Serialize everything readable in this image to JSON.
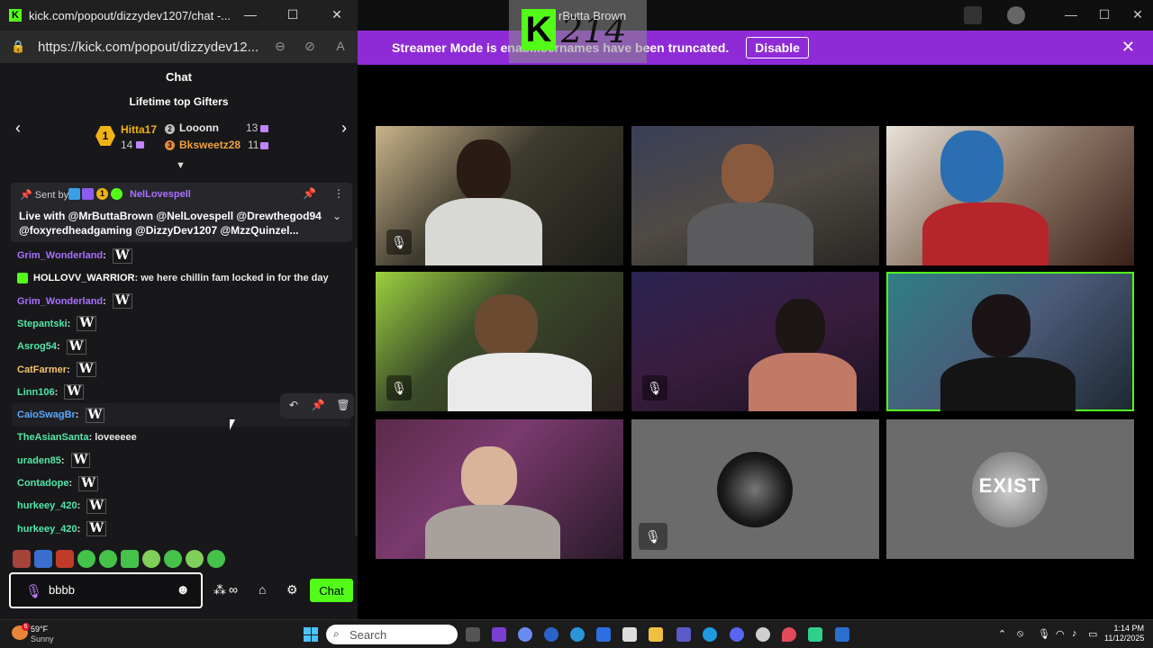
{
  "colors": {
    "kick_green": "#53fc18",
    "banner_purple": "#8f2bd6",
    "chat_bg": "#18181b",
    "gold": "#f0b316"
  },
  "browser": {
    "title": "kick.com/popout/dizzydev1207/chat -...",
    "url": "https://kick.com/popout/dizzydev12...",
    "minimize_icon": "minimize-icon",
    "maximize_icon": "maximize-icon",
    "close_icon": "close-icon"
  },
  "stream_overlay": {
    "logo_letter": "K",
    "number": "214",
    "streamer_name": "rButta Brown"
  },
  "banner": {
    "text": "Streamer Mode is enab...sernames have been truncated.",
    "disable_label": "Disable",
    "close_icon": "close-icon"
  },
  "chat": {
    "header_title": "Chat",
    "gifters": {
      "title": "Lifetime top Gifters",
      "first": {
        "rank": "1",
        "name": "Hitta17",
        "count": "14"
      },
      "second": {
        "rank": "2",
        "name": "Looonn",
        "count": "13"
      },
      "third": {
        "rank": "3",
        "name": "Bksweetz28",
        "count": "11"
      }
    },
    "pinned": {
      "sent_by_label": "Sent by",
      "user": "NelLovespell",
      "badge_number": "1",
      "text": "Live with @MrButtaBrown @NelLovespell @Drewthegod94 @foxyredheadgaming @DizzyDev1207 @MzzQuinzel..."
    },
    "messages": [
      {
        "user": "Grim_Wonderland",
        "color": "#a970ff",
        "text": "",
        "emote": "W"
      },
      {
        "user": "HOLLOVV_WARRIOR",
        "color": "#ffffff",
        "text": "we here chillin fam locked in for the day",
        "emote": ""
      },
      {
        "user": "Grim_Wonderland",
        "color": "#a970ff",
        "text": "",
        "emote": "W"
      },
      {
        "user": "Stepantski",
        "color": "#53e8a8",
        "text": "",
        "emote": "W"
      },
      {
        "user": "Asrog54",
        "color": "#53e8a8",
        "text": "",
        "emote": "W"
      },
      {
        "user": "CatFarmer",
        "color": "#f5c46b",
        "text": "",
        "emote": "W"
      },
      {
        "user": "Linn106",
        "color": "#53e8a8",
        "text": "",
        "emote": "W"
      },
      {
        "user": "CaioSwagBr",
        "color": "#5aa9ff",
        "text": "",
        "emote": "W"
      },
      {
        "user": "TheAsianSanta",
        "color": "#53e8a8",
        "text": "loveeeee",
        "emote": ""
      },
      {
        "user": "uraden85",
        "color": "#53e8a8",
        "text": "",
        "emote": "W"
      },
      {
        "user": "Contadope",
        "color": "#53e8a8",
        "text": "",
        "emote": "W"
      },
      {
        "user": "hurkeey_420",
        "color": "#53e8a8",
        "text": "",
        "emote": "W"
      },
      {
        "user": "hurkeey_420",
        "color": "#53e8a8",
        "text": "",
        "emote": "W"
      }
    ],
    "input_value": "bbbb",
    "send_label": "Chat"
  },
  "taskbar": {
    "temperature": "59°F",
    "condition": "Sunny",
    "weather_badge": "6",
    "search_label": "Search",
    "time": "1:14 PM",
    "date": "11/12/2025"
  }
}
